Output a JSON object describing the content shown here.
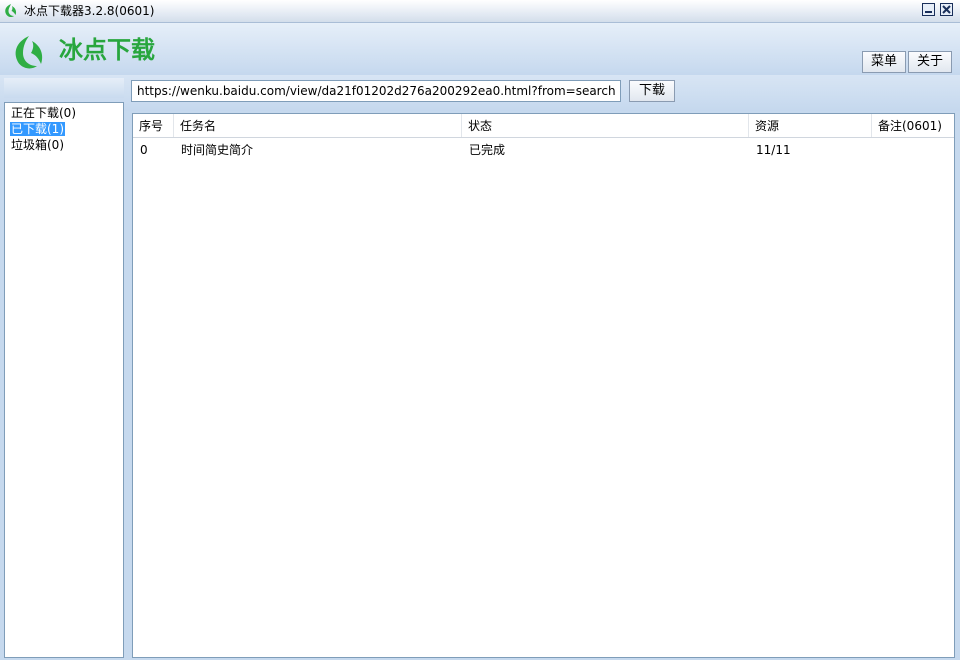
{
  "window": {
    "title": "冰点下载器3.2.8(0601)",
    "icon": "leaf-logo-icon",
    "accent": "#28a63e"
  },
  "header": {
    "logo_text": "冰点下载",
    "menu_label": "菜单",
    "about_label": "关于"
  },
  "toolbar": {
    "url_value": "https://wenku.baidu.com/view/da21f01202d276a200292ea0.html?from=search",
    "download_label": "下载"
  },
  "sidebar": {
    "items": [
      {
        "label": "正在下载(0)",
        "selected": false
      },
      {
        "label": "已下载(1)",
        "selected": true
      },
      {
        "label": "垃圾箱(0)",
        "selected": false
      }
    ]
  },
  "table": {
    "columns": [
      "序号",
      "任务名",
      "状态",
      "资源",
      "备注(0601)"
    ],
    "rows": [
      [
        "0",
        "时间简史简介",
        "已完成",
        "11/11",
        ""
      ]
    ]
  }
}
